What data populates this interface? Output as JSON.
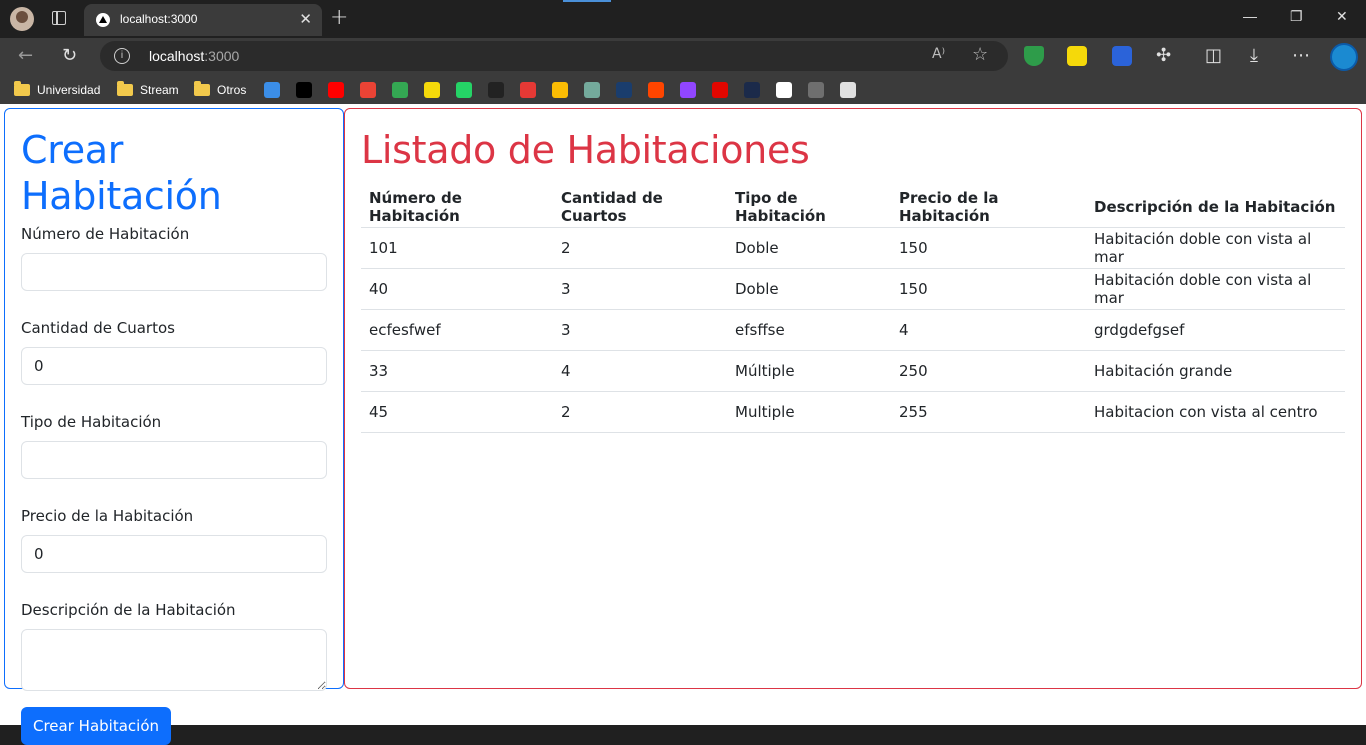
{
  "browser": {
    "tab_title": "localhost:3000",
    "close_symbol": "✕",
    "new_tab_symbol": "+",
    "url_host": "localhost",
    "url_port": ":3000",
    "window_controls": {
      "minimize": "—",
      "restore": "❐",
      "close": "✕"
    },
    "bookmarks": [
      {
        "label": "Universidad",
        "icon": "folder-icon"
      },
      {
        "label": "Stream",
        "icon": "folder-icon"
      },
      {
        "label": "Otros",
        "icon": "folder-icon"
      }
    ],
    "bookmark_icons": [
      {
        "name": "drop-icon",
        "color": "#3b8ee8"
      },
      {
        "name": "x-icon",
        "color": "#000000"
      },
      {
        "name": "youtube-icon",
        "color": "#ff0000"
      },
      {
        "name": "gmail-icon",
        "color": "#ea4335"
      },
      {
        "name": "drive-icon",
        "color": "#34a853"
      },
      {
        "name": "yellow-note-icon",
        "color": "#f5d90a"
      },
      {
        "name": "whatsapp-icon",
        "color": "#25d366"
      },
      {
        "name": "appletv-icon",
        "color": "#222222"
      },
      {
        "name": "star-icon",
        "color": "#e53935"
      },
      {
        "name": "keep-icon",
        "color": "#fbbc04"
      },
      {
        "name": "chatgpt-icon",
        "color": "#74aa9c"
      },
      {
        "name": "blue-shield-icon",
        "color": "#1a3d6d"
      },
      {
        "name": "reddit-icon",
        "color": "#ff4500"
      },
      {
        "name": "twitch-icon",
        "color": "#9146ff"
      },
      {
        "name": "f1-icon",
        "color": "#e10600"
      },
      {
        "name": "fia-icon",
        "color": "#1b2a4a"
      },
      {
        "name": "github-icon",
        "color": "#ffffff"
      },
      {
        "name": "globe-icon",
        "color": "#6f6f6f"
      },
      {
        "name": "rss-icon",
        "color": "#e0e0e0"
      }
    ]
  },
  "form": {
    "title": "Crear Habitación",
    "fields": {
      "numero": {
        "label": "Número de Habitación",
        "value": ""
      },
      "cuartos": {
        "label": "Cantidad de Cuartos",
        "value": "0"
      },
      "tipo": {
        "label": "Tipo de Habitación",
        "value": ""
      },
      "precio": {
        "label": "Precio de la Habitación",
        "value": "0"
      },
      "descripcion": {
        "label": "Descripción de la Habitación",
        "value": ""
      }
    },
    "submit_label": "Crear Habitación"
  },
  "list": {
    "title": "Listado de Habitaciones",
    "headers": [
      "Número de Habitación",
      "Cantidad de Cuartos",
      "Tipo de Habitación",
      "Precio de la Habitación",
      "Descripción de la Habitación"
    ],
    "rows": [
      [
        "101",
        "2",
        "Doble",
        "150",
        "Habitación doble con vista al mar"
      ],
      [
        "40",
        "3",
        "Doble",
        "150",
        "Habitación doble con vista al mar"
      ],
      [
        "ecfesfwef",
        "3",
        "efsffse",
        "4",
        "grdgdefgsef"
      ],
      [
        "33",
        "4",
        "Múltiple",
        "250",
        "Habitación grande"
      ],
      [
        "45",
        "2",
        "Multiple",
        "255",
        "Habitacion con vista al centro"
      ]
    ]
  },
  "colors": {
    "primary": "#0d6efd",
    "danger": "#dc3545"
  }
}
